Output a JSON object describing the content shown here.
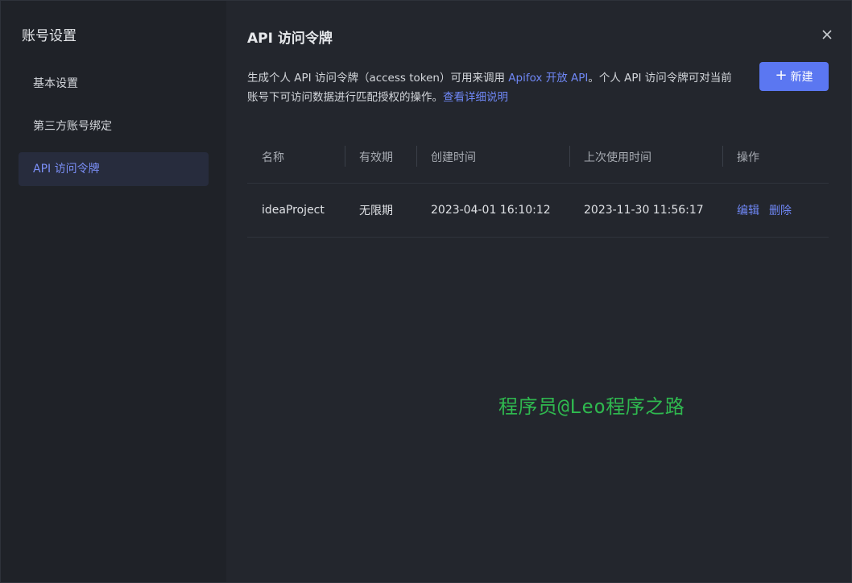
{
  "sidebar": {
    "title": "账号设置",
    "items": [
      {
        "label": "基本设置"
      },
      {
        "label": "第三方账号绑定"
      },
      {
        "label": "API 访问令牌"
      }
    ]
  },
  "main": {
    "title": "API 访问令牌",
    "close_icon": "close-icon",
    "description": {
      "part1": "生成个人 API 访问令牌（access token）可用来调用 ",
      "link1": "Apifox 开放 API",
      "part2": "。个人 API 访问令牌可对当前账号下可访问数据进行匹配授权的操作。",
      "link2": "查看详细说明"
    },
    "new_button": {
      "icon": "+",
      "label": "新建"
    },
    "table": {
      "headers": [
        "名称",
        "有效期",
        "创建时间",
        "上次使用时间",
        "操作"
      ],
      "rows": [
        {
          "name": "ideaProject",
          "validity": "无限期",
          "created": "2023-04-01 16:10:12",
          "last_used": "2023-11-30 11:56:17",
          "edit": "编辑",
          "delete": "删除"
        }
      ]
    }
  },
  "watermark": "程序员@Leo程序之路",
  "colors": {
    "accent": "#5b77f1",
    "link": "#6f87f5",
    "active_item_bg": "#272c3d",
    "watermark": "#2fb84f"
  }
}
